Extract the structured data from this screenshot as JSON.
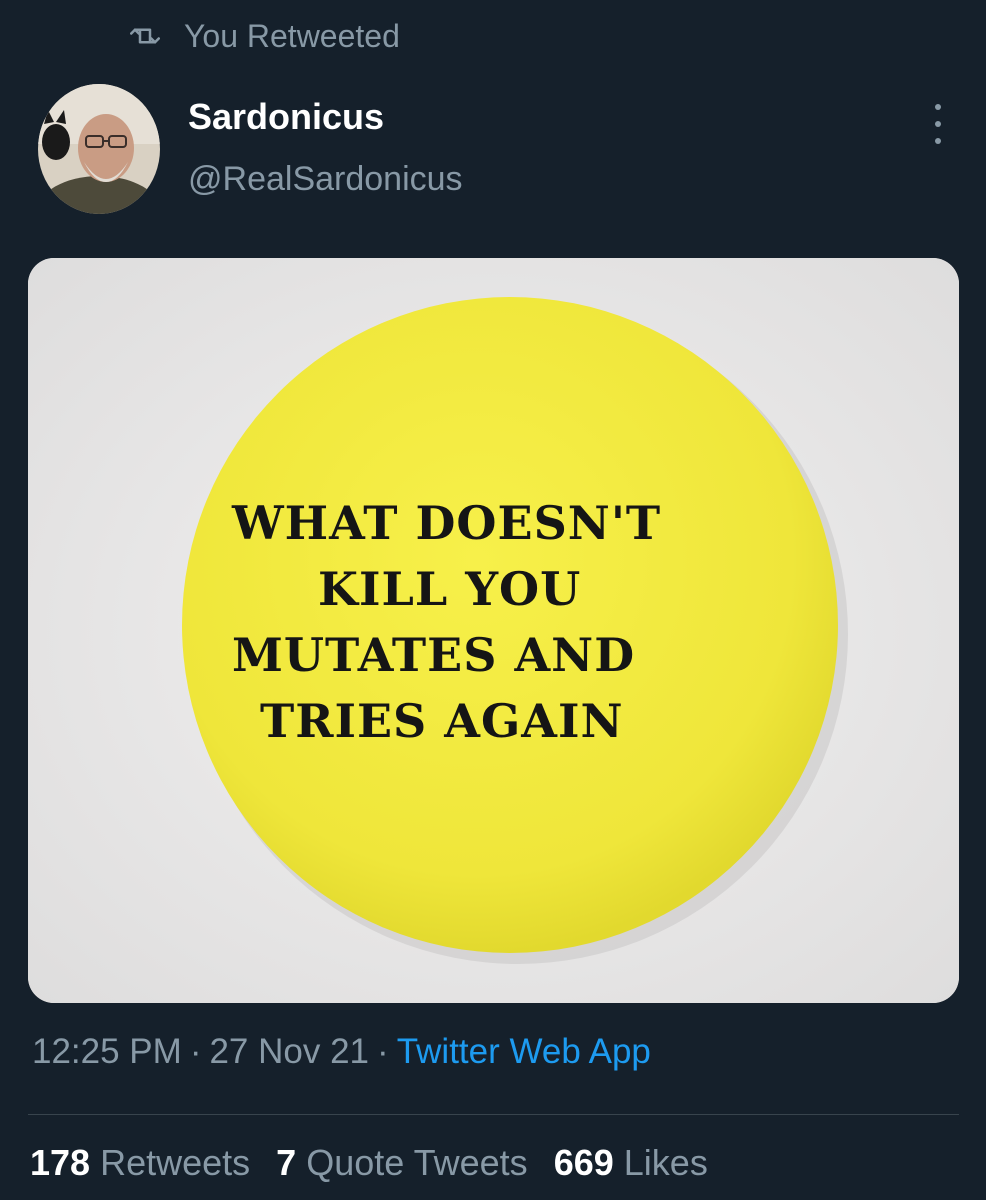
{
  "retweet_banner": {
    "icon": "retweet-icon",
    "label": "You Retweeted"
  },
  "author": {
    "name": "Sardonicus",
    "handle": "@RealSardonicus"
  },
  "media": {
    "button_text_lines": [
      "WHAT DOESN'T",
      "KILL YOU",
      "MUTATES AND",
      "TRIES AGAIN"
    ],
    "button_color": "#f3ec3f"
  },
  "meta": {
    "time": "12:25 PM",
    "separator": "·",
    "date": "27 Nov 21",
    "source": "Twitter Web App"
  },
  "stats": {
    "retweets_count": "178",
    "retweets_label": "Retweets",
    "quotes_count": "7",
    "quotes_label": "Quote Tweets",
    "likes_count": "669",
    "likes_label": "Likes"
  },
  "colors": {
    "background": "#15202b",
    "secondary_text": "#8899a6",
    "link": "#1d9bf0"
  }
}
